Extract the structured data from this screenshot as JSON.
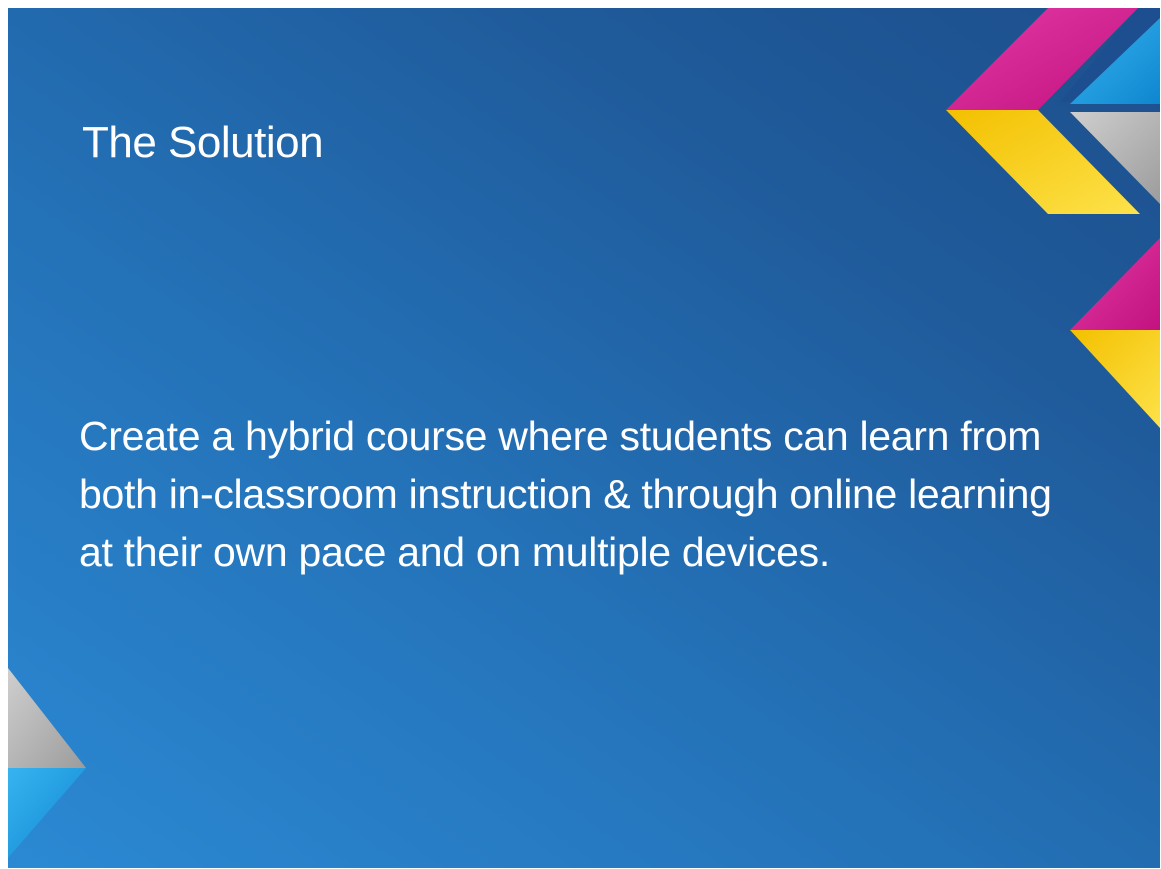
{
  "slide": {
    "title": "The Solution",
    "body": "Create a hybrid course where students can learn from both in-classroom instruction & through online learning at their own pace and on multiple devices."
  },
  "colors": {
    "background_light": "#2b89d3",
    "background_dark": "#1d4f8c",
    "text": "#ffffff",
    "accent_magenta": "#d4178f",
    "accent_yellow": "#f7c70c",
    "accent_gray": "#b2b2b2",
    "accent_cyan": "#1996dc",
    "accent_navy": "#1d4e8f"
  }
}
